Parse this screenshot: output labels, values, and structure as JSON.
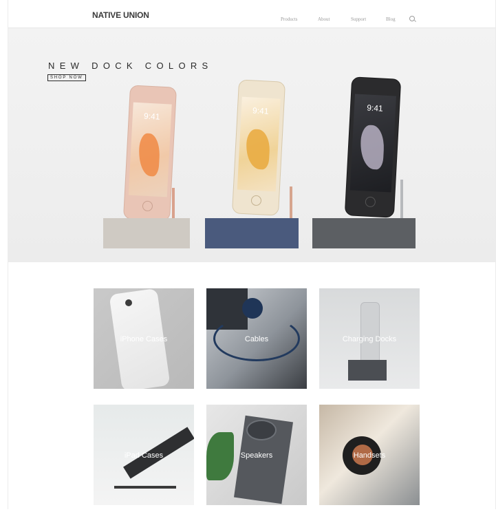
{
  "brand": "NATIVE UNION",
  "nav": {
    "items": [
      "Products",
      "About",
      "Support",
      "Blog"
    ],
    "search_icon": "search-icon"
  },
  "hero": {
    "title": "NEW DOCK COLORS",
    "cta": "SHOP NOW",
    "phone_time": "9:41"
  },
  "categories": [
    "iPhone Cases",
    "Cables",
    "Charging Docks",
    "iPad Cases",
    "Speakers",
    "Handsets"
  ],
  "colors": {
    "dock_stone": "#cfcac3",
    "dock_navy": "#4a5a7d",
    "dock_slate": "#5c5f63",
    "rose_gold": "#e9c5b6",
    "gold": "#e6d3b3",
    "space_gray": "#2b2b2d"
  }
}
